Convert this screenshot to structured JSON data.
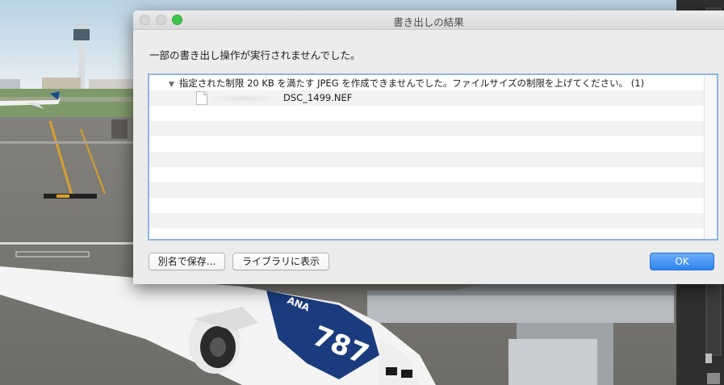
{
  "dialog": {
    "title": "書き出しの結果",
    "message": "一部の書き出し操作が実行されませんでした。",
    "list": {
      "group_label": "指定された制限 20 KB を満たす JPEG を作成できませんでした。ファイルサイズの制限を上げてください。 (1)",
      "disclosure_icon": "disclosure-triangle-open",
      "files": [
        {
          "name": "DSC_1499.NEF",
          "icon": "document-icon"
        }
      ]
    },
    "buttons": {
      "save_as": "別名で保存...",
      "show_in_library": "ライブラリに表示",
      "ok": "OK"
    },
    "colors": {
      "ok_button": "#2f84f0",
      "list_focus_ring": "#8fb4e6",
      "zoom_light": "#3cc44a"
    }
  }
}
